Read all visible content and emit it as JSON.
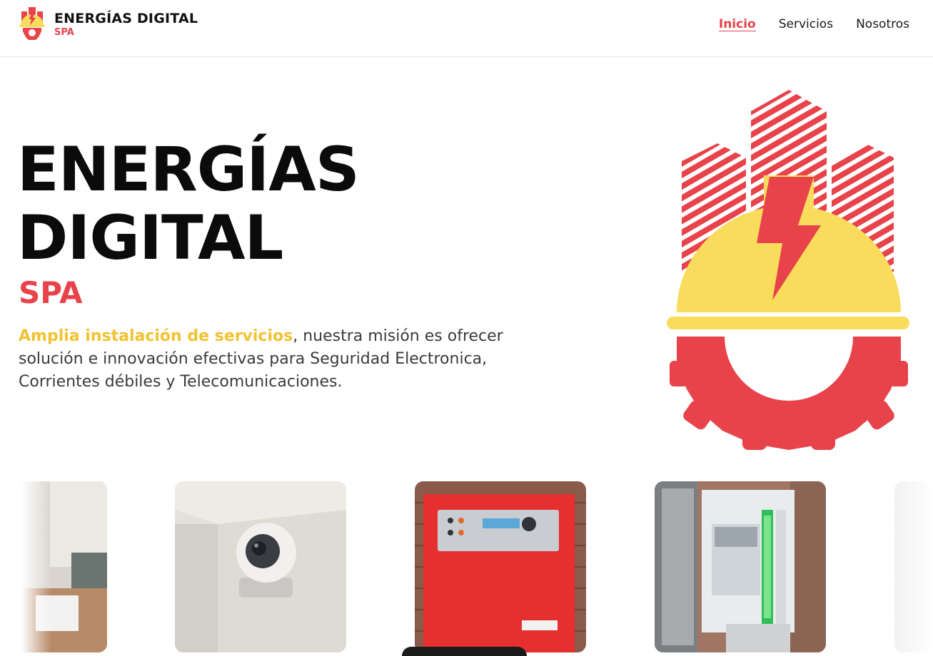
{
  "brand": {
    "name": "ENERGÍAS DIGITAL",
    "suffix": "SPA"
  },
  "nav": {
    "items": [
      "Inicio",
      "Servicios",
      "Nosotros"
    ],
    "active": "Inicio"
  },
  "hero": {
    "title_line1": "ENERGÍAS",
    "title_line2": "DIGITAL",
    "subtitle": "SPA",
    "highlight": "Amplia instalación de servicios",
    "description": ", nuestra misión es ofrecer solución e innovación efectivas para Seguridad Electronica, Corrientes débiles y Telecomunicaciones."
  },
  "colors": {
    "accent_red": "#e8434a",
    "accent_yellow": "#f9dc5c",
    "highlight_yellow": "#f2c230",
    "text_dark": "#0b0b0b"
  },
  "gallery": {
    "images": [
      "photo-electrical-work",
      "photo-security-camera",
      "photo-fire-alarm-panel",
      "photo-power-supply-box",
      "photo-partial"
    ]
  }
}
